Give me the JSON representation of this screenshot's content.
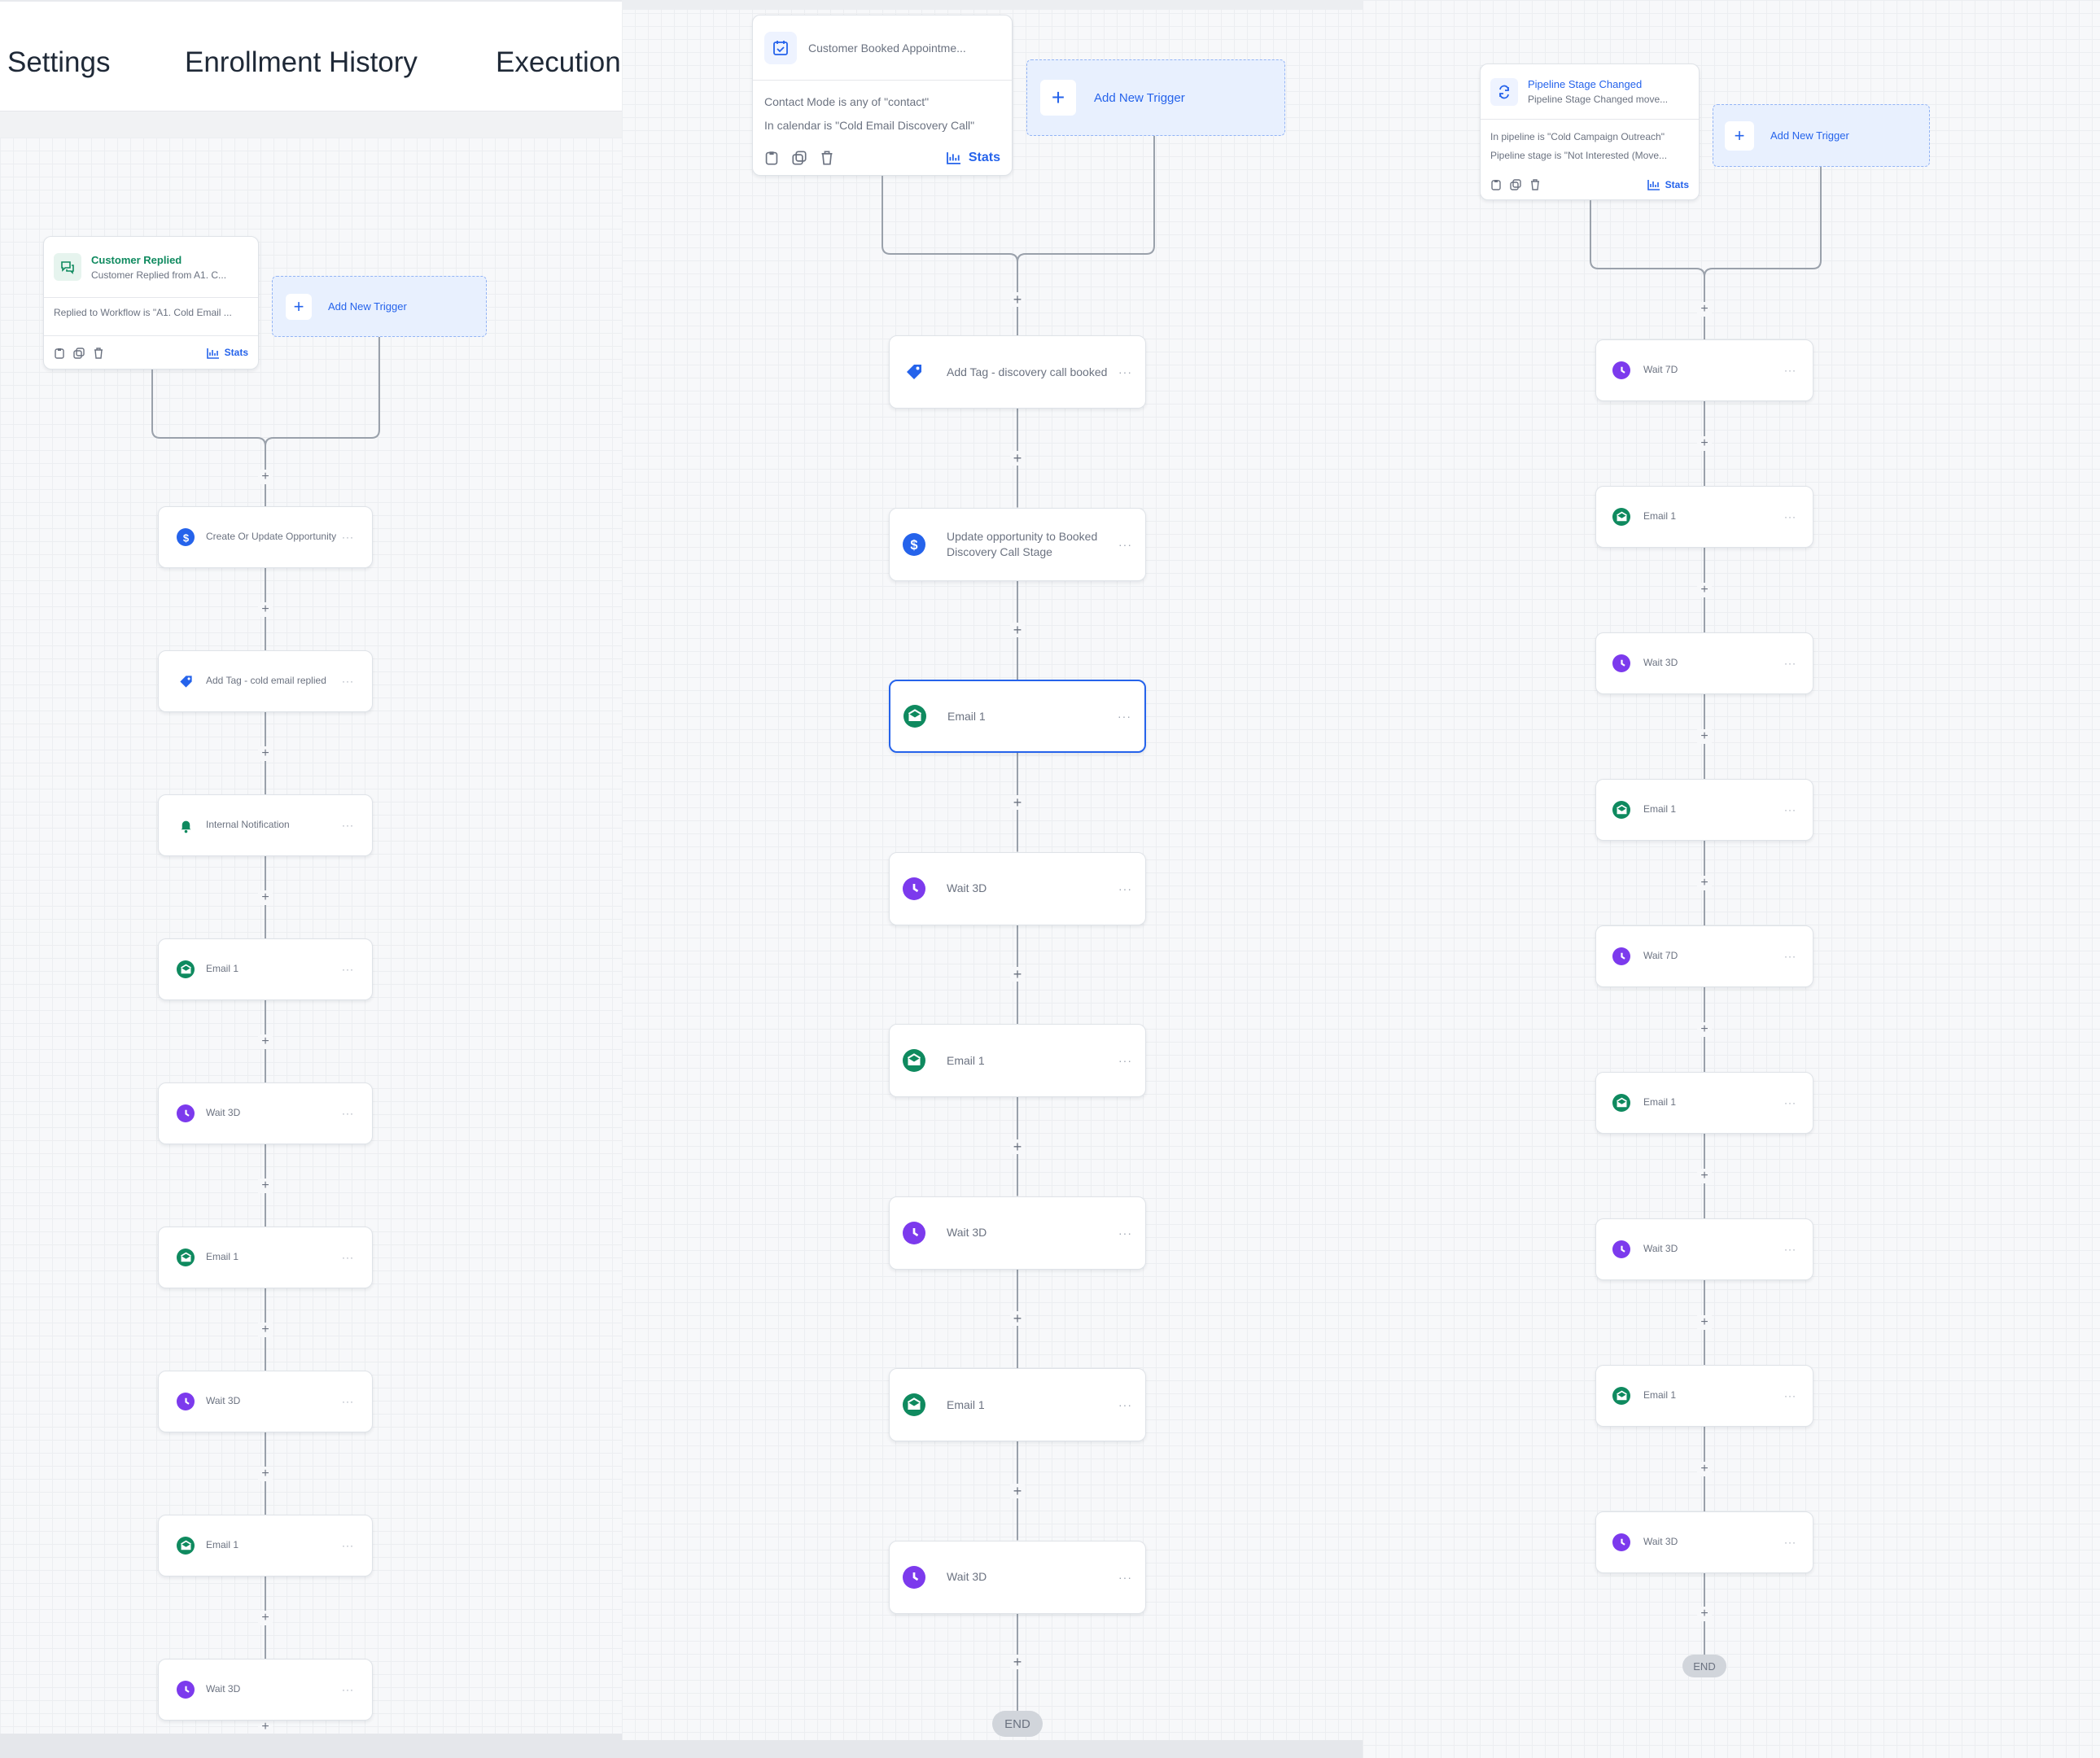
{
  "panel1": {
    "tabs": [
      "Settings",
      "Enrollment History",
      "Execution"
    ],
    "trigger": {
      "title": "Customer Replied",
      "subtitle": "Customer Replied from A1. C...",
      "condition": "Replied to Workflow is \"A1. Cold Email ...",
      "stats": "Stats"
    },
    "add_trigger": "Add New Trigger",
    "actions": [
      {
        "label": "Create Or Update Opportunity",
        "icon": "dollar-icon"
      },
      {
        "label": "Add Tag - cold email replied",
        "icon": "tag-icon"
      },
      {
        "label": "Internal Notification",
        "icon": "bell-icon"
      },
      {
        "label": "Email 1",
        "icon": "email-icon"
      },
      {
        "label": "Wait 3D",
        "icon": "clock-icon"
      },
      {
        "label": "Email 1",
        "icon": "email-icon"
      },
      {
        "label": "Wait 3D",
        "icon": "clock-icon"
      },
      {
        "label": "Email 1",
        "icon": "email-icon"
      },
      {
        "label": "Wait 3D",
        "icon": "clock-icon"
      }
    ]
  },
  "panel2": {
    "trigger": {
      "title": "Customer Booked Appointme...",
      "condition1": "Contact Mode is any of \"contact\"",
      "condition2": "In calendar is \"Cold Email Discovery Call\"",
      "stats": "Stats"
    },
    "add_trigger": "Add New Trigger",
    "actions": [
      {
        "label": "Add Tag - discovery call booked",
        "icon": "tag-icon"
      },
      {
        "label": "Update opportunity to Booked Discovery Call Stage",
        "icon": "dollar-icon"
      },
      {
        "label": "Email 1",
        "icon": "email-icon",
        "selected": true
      },
      {
        "label": "Wait 3D",
        "icon": "clock-icon"
      },
      {
        "label": "Email 1",
        "icon": "email-icon"
      },
      {
        "label": "Wait 3D",
        "icon": "clock-icon"
      },
      {
        "label": "Email 1",
        "icon": "email-icon"
      },
      {
        "label": "Wait 3D",
        "icon": "clock-icon"
      }
    ],
    "end_label": "END"
  },
  "panel3": {
    "trigger": {
      "title": "Pipeline Stage Changed",
      "subtitle": "Pipeline Stage Changed move...",
      "condition1": "In pipeline is \"Cold Campaign Outreach\"",
      "condition2": "Pipeline stage is \"Not Interested (Move...",
      "stats": "Stats"
    },
    "add_trigger": "Add New Trigger",
    "actions": [
      {
        "label": "Wait 7D",
        "icon": "clock-icon"
      },
      {
        "label": "Email 1",
        "icon": "email-icon"
      },
      {
        "label": "Wait 3D",
        "icon": "clock-icon"
      },
      {
        "label": "Email 1",
        "icon": "email-icon"
      },
      {
        "label": "Wait 7D",
        "icon": "clock-icon"
      },
      {
        "label": "Email 1",
        "icon": "email-icon"
      },
      {
        "label": "Wait 3D",
        "icon": "clock-icon"
      },
      {
        "label": "Email 1",
        "icon": "email-icon"
      },
      {
        "label": "Wait 3D",
        "icon": "clock-icon"
      }
    ],
    "end_label": "END"
  },
  "colors": {
    "email": "#0f8a5f",
    "clock": "#7c3aed",
    "blue": "#2563eb",
    "bell": "#0f8a5f"
  },
  "more_label": "···"
}
